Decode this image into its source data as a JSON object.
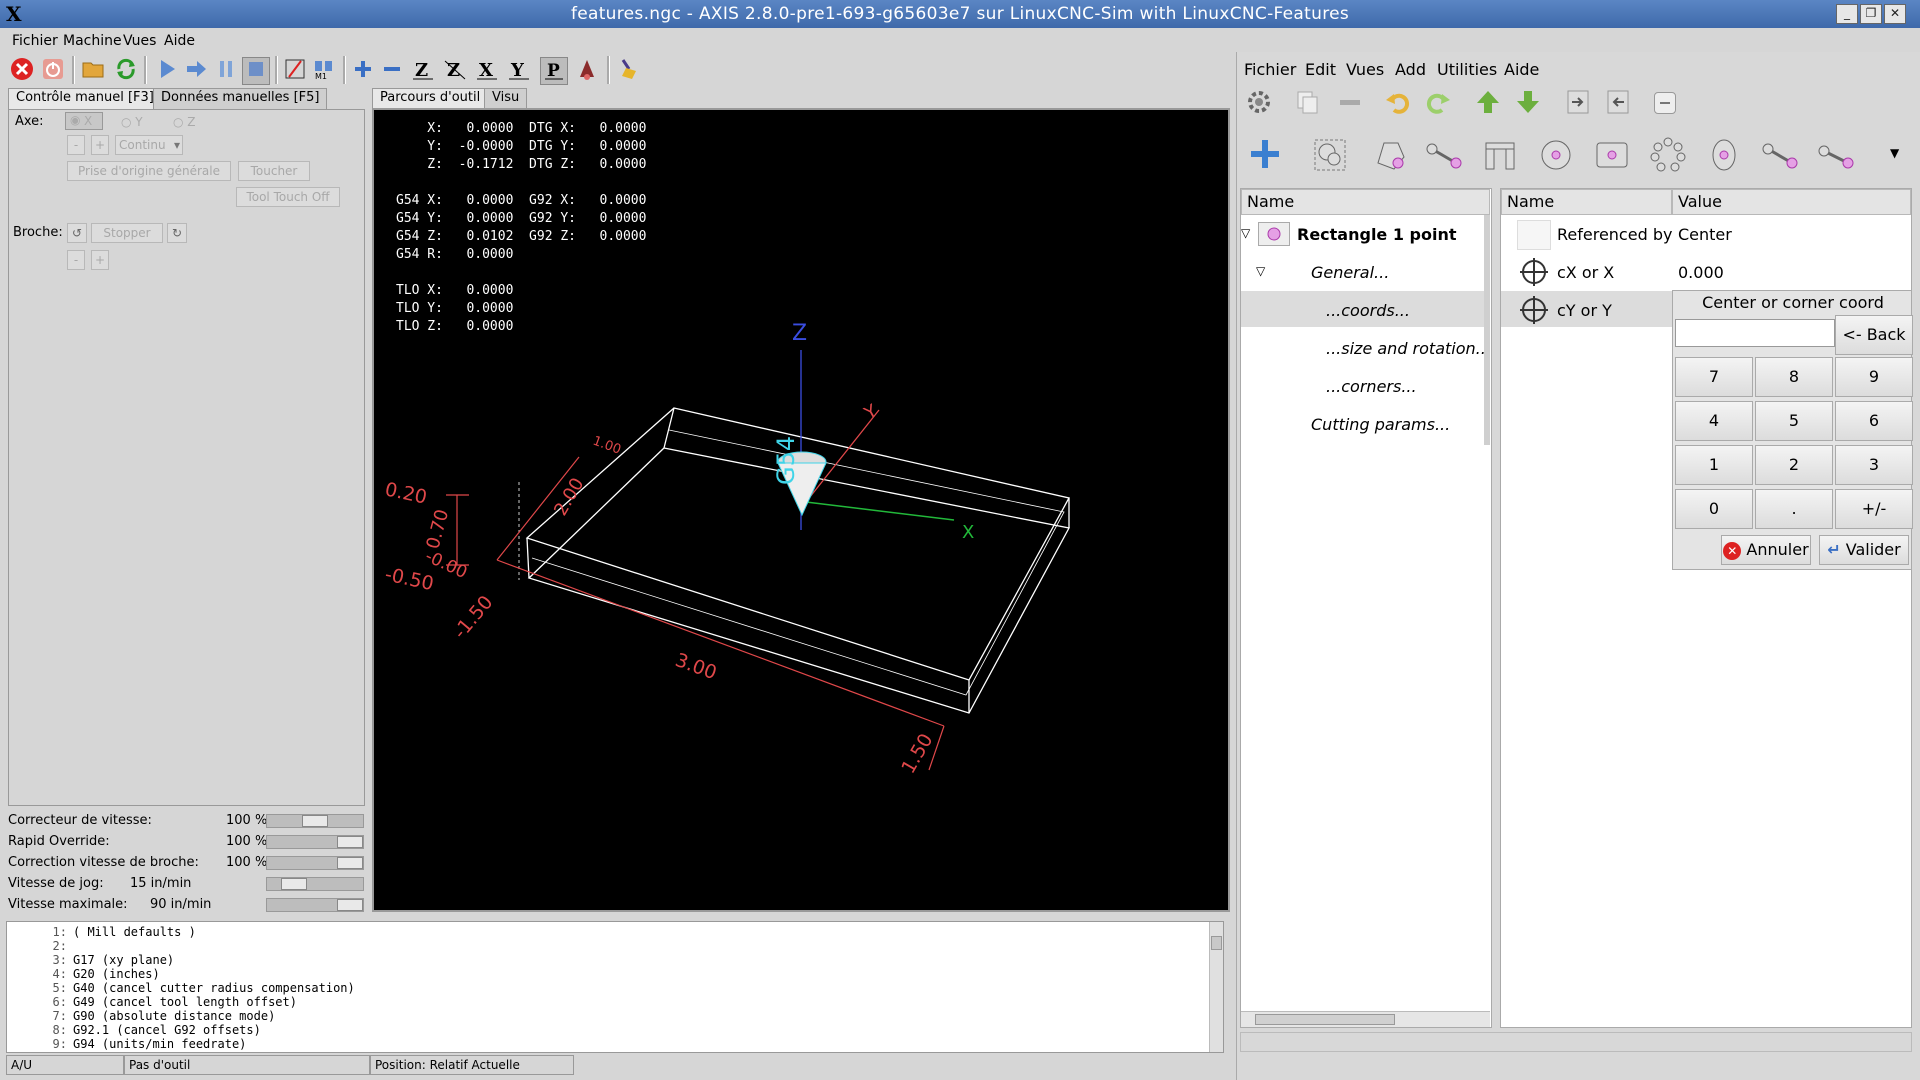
{
  "window": {
    "title": "features.ngc - AXIS 2.8.0-pre1-693-g65603e7 sur LinuxCNC-Sim with LinuxCNC-Features",
    "logo": "X",
    "buttons": [
      "_",
      "❐",
      "✕"
    ]
  },
  "left_menu": [
    "Fichier",
    "Machine",
    "Vues",
    "Aide"
  ],
  "left_tabs": [
    "Contrôle manuel [F3]",
    "Données manuelles [F5]"
  ],
  "manual": {
    "axe_label": "Axe:",
    "axes": [
      "X",
      "Y",
      "Z"
    ],
    "minus": "-",
    "plus": "+",
    "continu": "Continu",
    "home_button": "Prise d'origine générale",
    "touch_button": "Toucher",
    "tool_touch_off": "Tool Touch Off",
    "broche_label": "Broche:",
    "stop_button": "Stopper"
  },
  "overrides": [
    {
      "label": "Correcteur de vitesse:",
      "value": "100 %",
      "level": 0.5
    },
    {
      "label": "Rapid Override:",
      "value": "100 %",
      "level": 1.0
    },
    {
      "label": "Correction vitesse de broche:",
      "value": "100 %",
      "level": 1.0
    },
    {
      "label": "Vitesse de jog:",
      "value": "15 in/min",
      "level": 0.2
    },
    {
      "label": "Vitesse maximale:",
      "value": "90 in/min",
      "level": 1.0
    }
  ],
  "view_tabs": [
    "Parcours d'outil",
    "Visu"
  ],
  "dro_lines": [
    "    X:   0.0000  DTG X:   0.0000",
    "    Y:  -0.0000  DTG Y:   0.0000",
    "    Z:  -0.1712  DTG Z:   0.0000",
    "",
    "G54 X:   0.0000  G92 X:   0.0000",
    "G54 Y:   0.0000  G92 Y:   0.0000",
    "G54 Z:   0.0102  G92 Z:   0.0000",
    "G54 R:   0.0000",
    "",
    "TLO X:   0.0000",
    "TLO Y:   0.0000",
    "TLO Z:   0.0000"
  ],
  "preview_labels": {
    "z_axis": "Z",
    "y_axis": "Y",
    "x_axis": "X",
    "g54": "G54",
    "dim_top_a": "1.00",
    "dim_top_b": "2.00",
    "dim_z_a": "0.20",
    "dim_z_b": "0.70",
    "dim_z_c": "-0.00",
    "dim_z_d": "-0.50",
    "dim_x_left": "-1.50",
    "dim_x": "3.00",
    "dim_x_right": "1.50"
  },
  "gcode_lines": [
    {
      "n": "1:",
      "text": "( Mill defaults )"
    },
    {
      "n": "2:",
      "text": ""
    },
    {
      "n": "3:",
      "text": "G17 (xy plane)"
    },
    {
      "n": "4:",
      "text": "G20 (inches)"
    },
    {
      "n": "5:",
      "text": "G40 (cancel cutter radius compensation)"
    },
    {
      "n": "6:",
      "text": "G49 (cancel tool length offset)"
    },
    {
      "n": "7:",
      "text": "G90 (absolute distance mode)"
    },
    {
      "n": "8:",
      "text": "G92.1 (cancel G92 offsets)"
    },
    {
      "n": "9:",
      "text": "G94 (units/min feedrate)"
    }
  ],
  "status_bar": [
    "A/U",
    "Pas d'outil",
    "Position: Relatif Actuelle"
  ],
  "right_menu": [
    "Fichier",
    "Edit",
    "Vues",
    "Add",
    "Utilities",
    "Aide"
  ],
  "tree": {
    "header": "Name",
    "root": "Rectangle 1 point",
    "items": [
      "General...",
      "...coords...",
      "...size and rotation...",
      "...corners...",
      "Cutting params..."
    ]
  },
  "props": {
    "name_header": "Name",
    "value_header": "Value",
    "rows": [
      {
        "name": "Referenced by",
        "value": "Center"
      },
      {
        "name": "cX or X",
        "value": "0.000"
      },
      {
        "name": "cY or Y",
        "value": ""
      }
    ]
  },
  "keypad": {
    "title": "Center or corner coord",
    "input_value": "",
    "back": "<- Back",
    "keys": [
      "7",
      "8",
      "9",
      "4",
      "5",
      "6",
      "1",
      "2",
      "3",
      "0",
      ".",
      "+/-"
    ],
    "cancel": "Annuler",
    "ok": "Valider"
  },
  "colors": {
    "titlebar": "#4a77b8",
    "preview_bg": "#000000",
    "dim_red": "#e0484a",
    "axis_blue": "#3a4de0",
    "axis_green": "#22b83a",
    "cyan": "#3fd4e8"
  }
}
